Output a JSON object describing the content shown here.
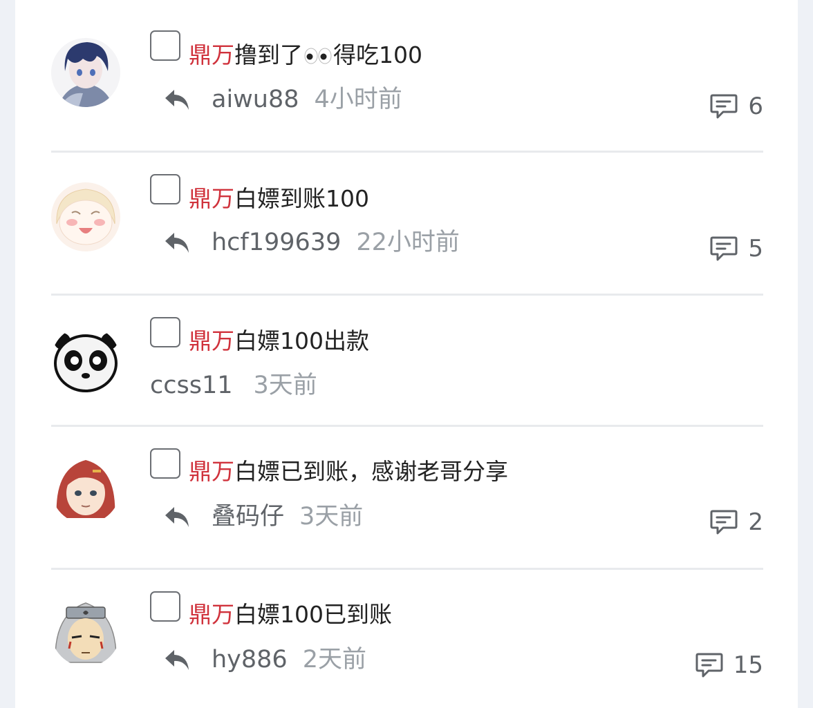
{
  "posts": [
    {
      "tag": "鼎万",
      "title": "撸到了",
      "title_after": "得吃100",
      "has_emoji": true,
      "emoji_name": "eyes-icon",
      "author": "aiwu88",
      "time": "4小时前",
      "comments": "6",
      "show_reply": true,
      "show_comments": true
    },
    {
      "tag": "鼎万",
      "title": "白嫖到账100",
      "title_after": "",
      "has_emoji": false,
      "author": "hcf199639",
      "time": "22小时前",
      "comments": "5",
      "show_reply": true,
      "show_comments": true
    },
    {
      "tag": "鼎万",
      "title": "白嫖100出款",
      "title_after": "",
      "has_emoji": false,
      "author": "ccss11",
      "time": "3天前",
      "comments": "",
      "show_reply": false,
      "show_comments": false
    },
    {
      "tag": "鼎万",
      "title": "白嫖已到账，感谢老哥分享",
      "title_after": "",
      "has_emoji": false,
      "author": "叠码仔",
      "time": "3天前",
      "comments": "2",
      "show_reply": true,
      "show_comments": true
    },
    {
      "tag": "鼎万",
      "title": "白嫖100已到账",
      "title_after": "",
      "has_emoji": false,
      "author": "hy886",
      "time": "2天前",
      "comments": "15",
      "show_reply": true,
      "show_comments": true
    }
  ],
  "icons": {
    "reply": "reply-icon",
    "comment": "comment-icon",
    "checkbox": "checkbox-icon"
  },
  "colors": {
    "tag": "#d0323c",
    "author": "#5f6368",
    "time": "#9aa0a6",
    "divider": "#e8eaed",
    "background": "#eef1f6"
  }
}
